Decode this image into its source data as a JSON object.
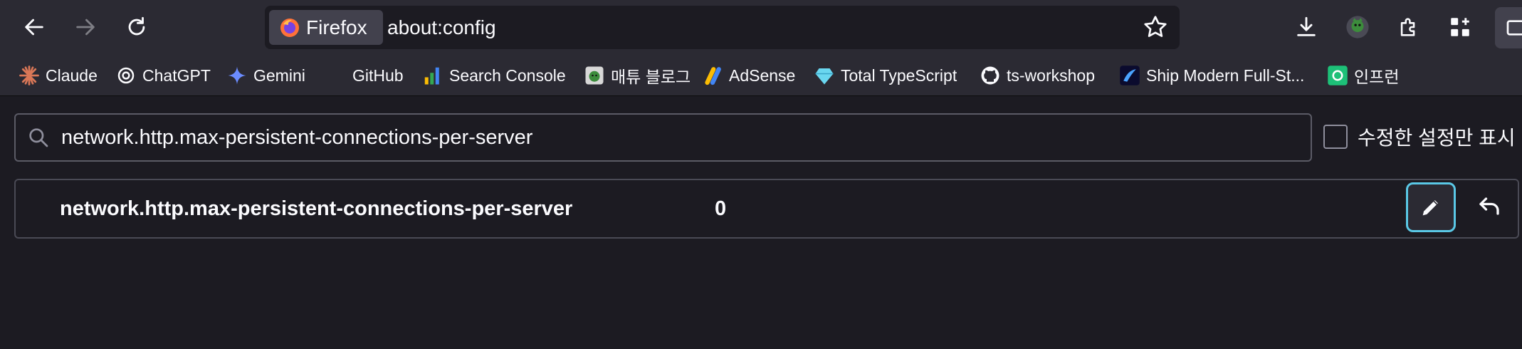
{
  "toolbar": {
    "identity_label": "Firefox",
    "url": "about:config"
  },
  "bookmarks": [
    {
      "label": "Claude",
      "icon": "claude-icon"
    },
    {
      "label": "ChatGPT",
      "icon": "chatgpt-icon"
    },
    {
      "label": "Gemini",
      "icon": "gemini-icon"
    },
    {
      "label": "GitHub",
      "icon": "github-blank-icon"
    },
    {
      "label": "Search Console",
      "icon": "search-console-icon"
    },
    {
      "label": "매튜 블로그",
      "icon": "blog-avatar-icon"
    },
    {
      "label": "AdSense",
      "icon": "adsense-icon"
    },
    {
      "label": "Total TypeScript",
      "icon": "diamond-icon"
    },
    {
      "label": "ts-workshop",
      "icon": "github-icon"
    },
    {
      "label": "Ship Modern Full-St...",
      "icon": "ship-icon"
    },
    {
      "label": "인프런",
      "icon": "inflearn-icon"
    }
  ],
  "config": {
    "search_value": "network.http.max-persistent-connections-per-server",
    "show_modified_label": "수정한 설정만 표시",
    "show_modified_checked": false,
    "pref_name": "network.http.max-persistent-connections-per-server",
    "pref_value": "0"
  },
  "colors": {
    "toolbar_bg": "#2b2a33",
    "content_bg": "#1c1b22",
    "focus_ring": "#5ac8e6"
  }
}
